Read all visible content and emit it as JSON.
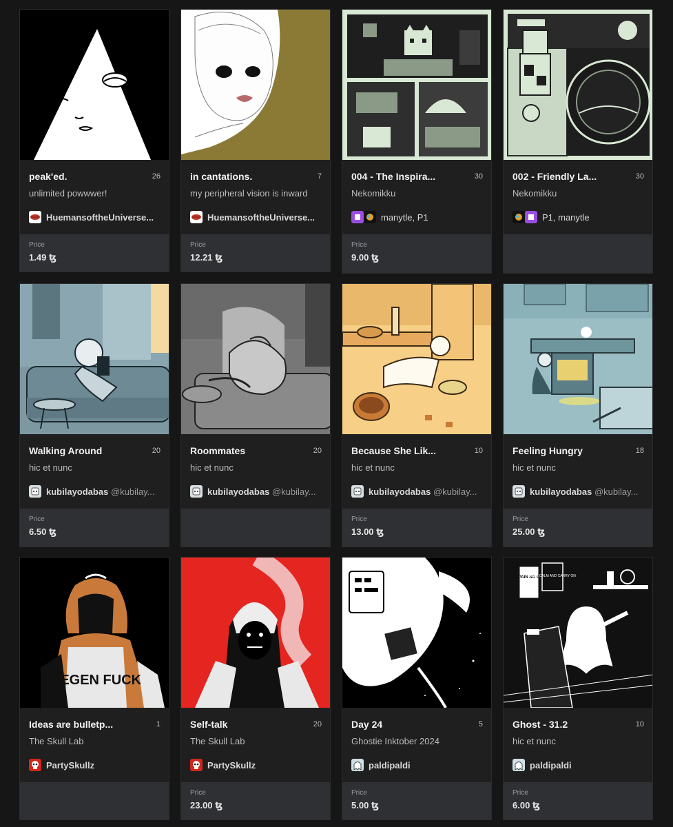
{
  "price_label": "Price",
  "cards": [
    {
      "title": "peak'ed.",
      "edition": "26",
      "subtitle": "unlimited powwwer!",
      "creator": "HuemansoftheUniverse...",
      "handle": "",
      "price": "1.49 ꜩ"
    },
    {
      "title": "in cantations.",
      "edition": "7",
      "subtitle": "my peripheral vision is inward",
      "creator": "HuemansoftheUniverse...",
      "handle": "",
      "price": "12.21 ꜩ"
    },
    {
      "title": "004 - The Inspira...",
      "edition": "30",
      "subtitle": "Nekomikku",
      "creator": "manytle, P1",
      "handle": "",
      "price": "9.00 ꜩ"
    },
    {
      "title": "002 - Friendly La...",
      "edition": "30",
      "subtitle": "Nekomikku",
      "creator": "P1, manytle",
      "handle": "",
      "price": ""
    },
    {
      "title": "Walking Around",
      "edition": "20",
      "subtitle": "hic et nunc",
      "creator": "kubilayodabas",
      "handle": "@kubilay...",
      "price": "6.50 ꜩ"
    },
    {
      "title": "Roommates",
      "edition": "20",
      "subtitle": "hic et nunc",
      "creator": "kubilayodabas",
      "handle": "@kubilay...",
      "price": ""
    },
    {
      "title": "Because She Lik...",
      "edition": "10",
      "subtitle": "hic et nunc",
      "creator": "kubilayodabas",
      "handle": "@kubilay...",
      "price": "13.00 ꜩ"
    },
    {
      "title": "Feeling Hungry",
      "edition": "18",
      "subtitle": "hic et nunc",
      "creator": "kubilayodabas",
      "handle": "@kubilay...",
      "price": "25.00 ꜩ"
    },
    {
      "title": "Ideas are bulletp...",
      "edition": "1",
      "subtitle": "The Skull Lab",
      "creator": "PartySkullz",
      "handle": "",
      "price": ""
    },
    {
      "title": "Self-talk",
      "edition": "20",
      "subtitle": "The Skull Lab",
      "creator": "PartySkullz",
      "handle": "",
      "price": "23.00 ꜩ"
    },
    {
      "title": "Day 24",
      "edition": "5",
      "subtitle": "Ghostie Inktober 2024",
      "creator": "paldipaldi",
      "handle": "",
      "price": "5.00 ꜩ"
    },
    {
      "title": "Ghost - 31.2",
      "edition": "10",
      "subtitle": "hic et nunc",
      "creator": "paldipaldi",
      "handle": "",
      "price": "6.00 ꜩ"
    }
  ],
  "artwork_text": {
    "degen": "DEGEN FUCK",
    "keep_calm": "KEEP CALM AND CARRY ON",
    "no_pain": "NO PAIN NO GAIN"
  },
  "colors": {
    "background": "#161616",
    "card": "#1f1f1f",
    "price_box": "#2e3034"
  }
}
